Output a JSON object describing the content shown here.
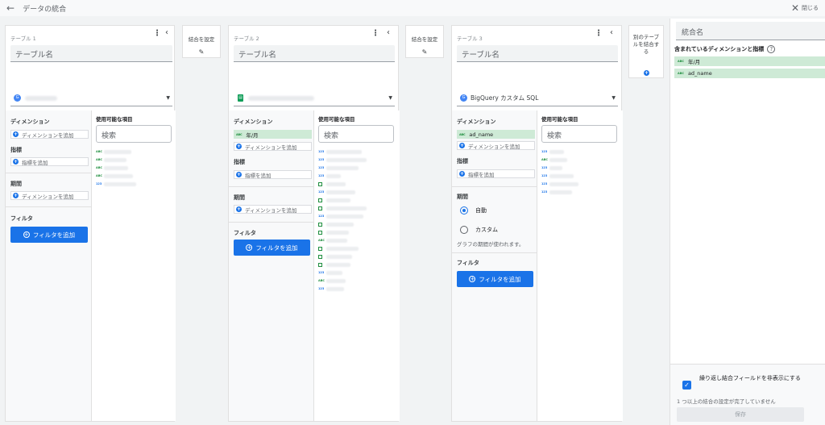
{
  "topbar": {
    "title": "データの統合",
    "close_label": "閉じる"
  },
  "icons": {
    "back": "back-arrow-icon",
    "close": "close-icon",
    "menu": "more-vert-icon",
    "collapse": "chevron-left-icon",
    "edit": "pencil-icon",
    "add": "plus-icon",
    "help": "help-icon"
  },
  "common": {
    "name_placeholder": "テーブル名",
    "dimension_header": "ディメンション",
    "metric_header": "指標",
    "period_header": "期間",
    "filter_header": "フィルタ",
    "available_header": "使用可能な項目",
    "search_placeholder": "検索",
    "add_dimension": "ディメンションを追加",
    "add_metric": "指標を追加",
    "add_filter": "フィルタを追加"
  },
  "tables": [
    {
      "title": "テーブル 1",
      "source": "",
      "dimensions": []
    },
    {
      "title": "テーブル 2",
      "source": "",
      "dimensions": [
        "年/月"
      ]
    },
    {
      "title": "テーブル 3",
      "source": "BigQuery カスタム SQL",
      "dimensions": [
        "ad_name"
      ],
      "period_options": [
        "自動",
        "カスタム"
      ],
      "period_selected": "自動",
      "period_note": "グラフの期間が使われます。"
    }
  ],
  "joins": [
    {
      "label": "結合を設定"
    },
    {
      "label": "結合を設定"
    }
  ],
  "add_table": {
    "label": "別のテーブルを結合する"
  },
  "right_panel": {
    "join_name_placeholder": "統合名",
    "included_header": "含まれているディメンションと指標",
    "included_fields": [
      "年/月",
      "ad_name"
    ],
    "type_badge": "ABC",
    "hide_repeat_label": "繰り返し結合フィールドを非表示にする",
    "hide_repeat_checked": true,
    "warning": "1 つ以上の結合の設定が完了していません",
    "save_label": "保存"
  },
  "colors": {
    "accent": "#1a73e8",
    "chip": "#ceead6",
    "panel_bg": "#f8f9fa"
  }
}
